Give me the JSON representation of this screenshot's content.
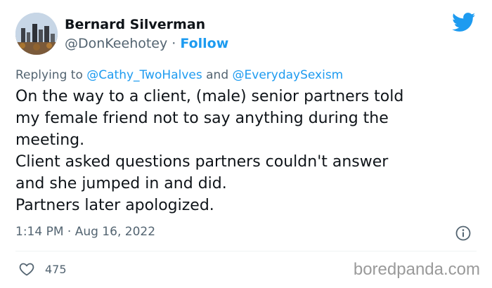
{
  "author": {
    "name": "Bernard Silverman",
    "handle": "@DonKeehotey",
    "separator": " · ",
    "follow_label": "Follow"
  },
  "reply": {
    "prefix": "Replying to ",
    "mention_1": "@Cathy_TwoHalves",
    "conjunction": " and ",
    "mention_2": "@EverydaySexism"
  },
  "tweet_lines": [
    "On the way to a client, (male) senior partners told",
    "my female friend not to say anything during the",
    "meeting.",
    "Client asked questions partners couldn't answer",
    "and she jumped in and did.",
    "Partners later apologized."
  ],
  "timestamp": "1:14 PM · Aug 16, 2022",
  "likes": "475",
  "watermark": "boredpanda.com",
  "colors": {
    "accent": "#1d9bf0",
    "secondary_text": "#536471",
    "primary_text": "#0f1419"
  },
  "icons": {
    "brand": "twitter-bird-icon",
    "info": "info-icon",
    "like": "heart-icon"
  }
}
